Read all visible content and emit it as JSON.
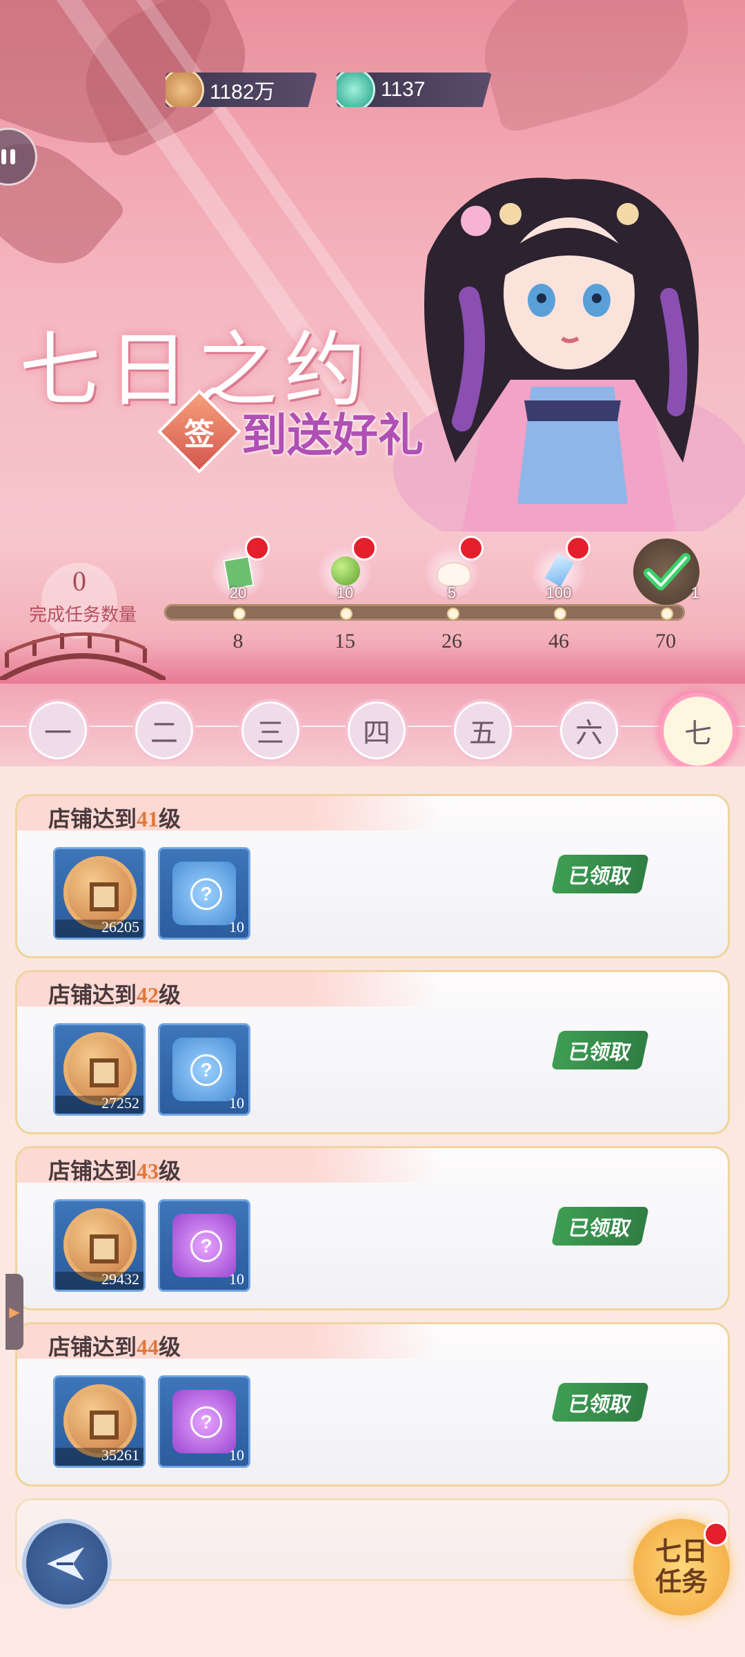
{
  "currency": {
    "coins": "1182万",
    "jade": "1137"
  },
  "banner": {
    "title": "七日之约",
    "subtitle_badge": "签",
    "subtitle": "到送好礼"
  },
  "progress": {
    "completed_count": "0",
    "completed_label": "完成任务数量",
    "milestones": [
      {
        "threshold": "8",
        "qty": "20",
        "item_icon": "banknote-icon",
        "has_notification": true,
        "claimed": false
      },
      {
        "threshold": "15",
        "qty": "10",
        "item_icon": "green-orb-icon",
        "has_notification": true,
        "claimed": false
      },
      {
        "threshold": "26",
        "qty": "5",
        "item_icon": "dumpling-icon",
        "has_notification": true,
        "claimed": false
      },
      {
        "threshold": "46",
        "qty": "100",
        "item_icon": "crystal-icon",
        "has_notification": true,
        "claimed": false
      },
      {
        "threshold": "70",
        "qty": "1",
        "item_icon": "chest-icon",
        "has_notification": false,
        "claimed": true
      }
    ]
  },
  "days": {
    "tabs": [
      "一",
      "二",
      "三",
      "四",
      "五",
      "六",
      "七"
    ],
    "active_index": 6
  },
  "tasks": [
    {
      "title_prefix": "店铺达到",
      "level": "41",
      "title_suffix": "级",
      "rewards": [
        {
          "icon": "copper-coin-icon",
          "qty": "26205"
        },
        {
          "icon": "blue-puzzle-icon",
          "qty": "10"
        }
      ],
      "status": "已领取"
    },
    {
      "title_prefix": "店铺达到",
      "level": "42",
      "title_suffix": "级",
      "rewards": [
        {
          "icon": "copper-coin-icon",
          "qty": "27252"
        },
        {
          "icon": "blue-puzzle-icon",
          "qty": "10"
        }
      ],
      "status": "已领取"
    },
    {
      "title_prefix": "店铺达到",
      "level": "43",
      "title_suffix": "级",
      "rewards": [
        {
          "icon": "copper-coin-icon",
          "qty": "29432"
        },
        {
          "icon": "purple-puzzle-icon",
          "qty": "10"
        }
      ],
      "status": "已领取"
    },
    {
      "title_prefix": "店铺达到",
      "level": "44",
      "title_suffix": "级",
      "rewards": [
        {
          "icon": "copper-coin-icon",
          "qty": "35261"
        },
        {
          "icon": "purple-puzzle-icon",
          "qty": "10"
        }
      ],
      "status": "已领取"
    }
  ],
  "bottom": {
    "task_button_line1": "七日",
    "task_button_line2": "任务",
    "back_icon": "back-arrow-icon"
  },
  "colors": {
    "accent_pink": "#ff9ec0",
    "level_orange": "#e0783a",
    "claimed_green": "#3e9e53",
    "notification_red": "#e61f2c"
  }
}
